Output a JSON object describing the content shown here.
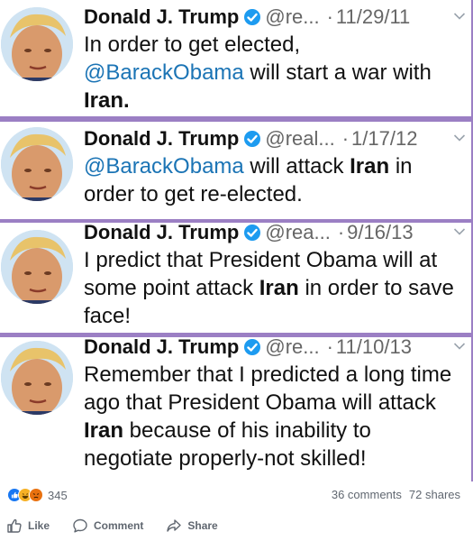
{
  "tweets": [
    {
      "name": "Donald J. Trump",
      "handle": "@re...",
      "date": "11/29/11",
      "body": [
        {
          "t": "In order to get elected,",
          "s": "text"
        },
        {
          "t": "\n",
          "s": "br"
        },
        {
          "t": "@BarackObama",
          "s": "mention"
        },
        {
          "t": " will start a war with",
          "s": "text"
        },
        {
          "t": "\n",
          "s": "br"
        },
        {
          "t": "Iran.",
          "s": "bold"
        }
      ]
    },
    {
      "name": "Donald J. Trump",
      "handle": "@real...",
      "date": "1/17/12",
      "body": [
        {
          "t": "@BarackObama",
          "s": "mention"
        },
        {
          "t": " will attack ",
          "s": "text"
        },
        {
          "t": "Iran",
          "s": "bold"
        },
        {
          "t": " in",
          "s": "text"
        },
        {
          "t": "\n",
          "s": "br"
        },
        {
          "t": "order to get re-elected.",
          "s": "text"
        }
      ]
    },
    {
      "name": "Donald J. Trump",
      "handle": "@rea...",
      "date": "9/16/13",
      "body": [
        {
          "t": "I predict that President Obama will at",
          "s": "text"
        },
        {
          "t": "\n",
          "s": "br"
        },
        {
          "t": "some point attack ",
          "s": "text"
        },
        {
          "t": "Iran",
          "s": "bold"
        },
        {
          "t": " in order to save",
          "s": "text"
        },
        {
          "t": "\n",
          "s": "br"
        },
        {
          "t": "face!",
          "s": "text"
        }
      ]
    },
    {
      "name": "Donald J. Trump",
      "handle": "@re...",
      "date": "11/10/13",
      "body": [
        {
          "t": "Remember that I predicted a long time",
          "s": "text"
        },
        {
          "t": "\n",
          "s": "br"
        },
        {
          "t": "ago that President Obama will attack",
          "s": "text"
        },
        {
          "t": "\n",
          "s": "br"
        },
        {
          "t": "Iran",
          "s": "bold"
        },
        {
          "t": " because of his inability to",
          "s": "text"
        },
        {
          "t": "\n",
          "s": "br"
        },
        {
          "t": "negotiate properly-not skilled!",
          "s": "text"
        }
      ]
    }
  ],
  "footer": {
    "reaction_icons": [
      "like-icon",
      "haha-icon",
      "angry-icon"
    ],
    "reaction_count": "345",
    "comments": "36 comments",
    "shares": "72 shares"
  },
  "actions": {
    "like": "Like",
    "comment": "Comment",
    "share": "Share"
  },
  "colors": {
    "mention": "#1b74b5",
    "verified": "#1d9bf0",
    "divider": "#9b7fc4",
    "meta": "#606770"
  }
}
